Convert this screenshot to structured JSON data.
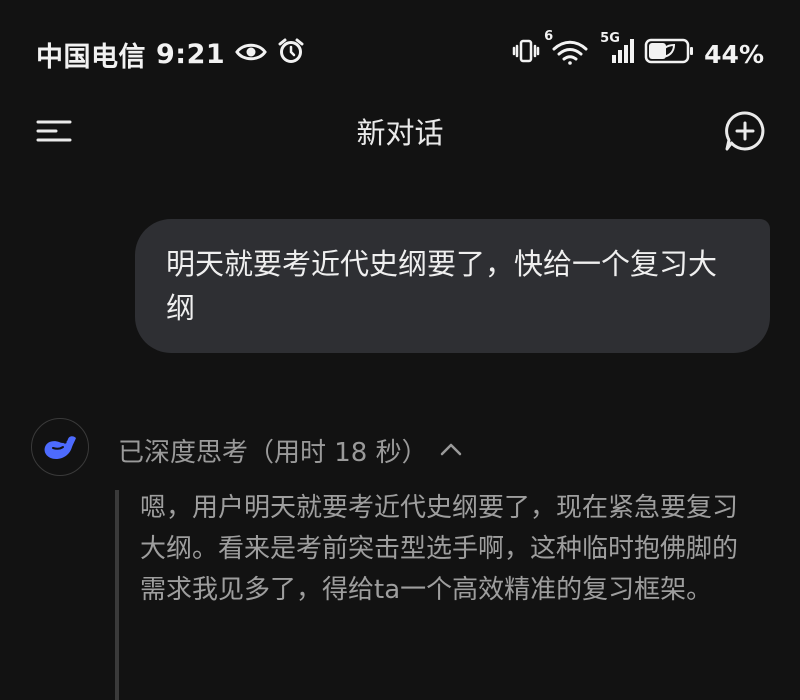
{
  "status_bar": {
    "carrier": "中国电信",
    "time": "9:21",
    "battery_percent": "44%",
    "network": "5G",
    "wifi_badge": "6"
  },
  "header": {
    "title": "新对话"
  },
  "conversation": {
    "user_message": "明天就要考近代史纲要了，快给一个复习大纲",
    "thinking": {
      "label": "已深度思考（用时 18 秒）",
      "text": "嗯，用户明天就要考近代史纲要了，现在紧急要复习大纲。看来是考前突击型选手啊，这种临时抱佛脚的需求我见多了，得给ta一个高效精准的复习框架。"
    }
  },
  "colors": {
    "background": "#121212",
    "bubble": "#2e2f33",
    "accent": "#4d6bfe",
    "muted_text": "#9a9a9a"
  }
}
